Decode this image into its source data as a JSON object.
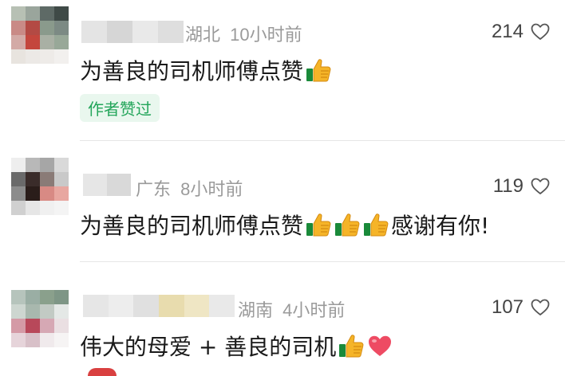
{
  "comments": [
    {
      "location": "湖北",
      "time": "10小时前",
      "likes": "214",
      "text": "为善良的司机师傅点赞",
      "emojis": [
        "thumbs-up"
      ],
      "badge": "作者赞过"
    },
    {
      "location": "广东",
      "time": "8小时前",
      "likes": "119",
      "text": "为善良的司机师傅点赞",
      "emojis": [
        "thumbs-up",
        "thumbs-up",
        "thumbs-up"
      ],
      "text_after": "感谢有你!"
    },
    {
      "location": "湖南",
      "time": "4小时前",
      "likes": "107",
      "text": "伟大的母爱 + 善良的司机",
      "emojis": [
        "thumbs-up",
        "red-heart"
      ]
    }
  ],
  "colors": {
    "badge_text": "#23a55a",
    "badge_bg": "#e9f7ee",
    "meta": "#9a9a9a"
  }
}
